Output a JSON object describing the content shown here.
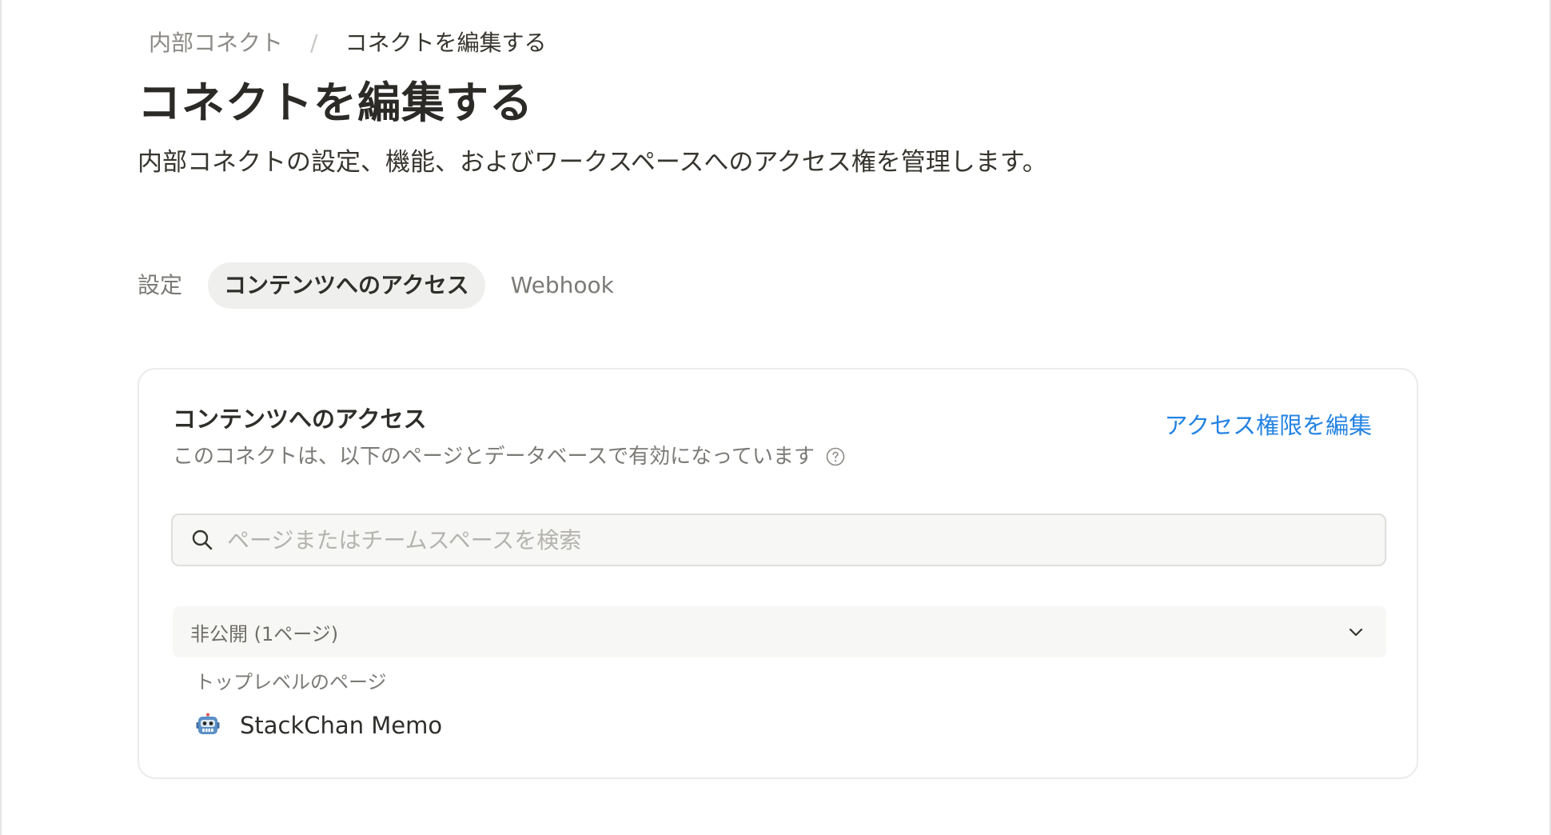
{
  "breadcrumb": {
    "parent": "内部コネクト",
    "separator": "/",
    "current": "コネクトを編集する"
  },
  "header": {
    "title": "コネクトを編集する",
    "description": "内部コネクトの設定、機能、およびワークスペースへのアクセス権を管理します。"
  },
  "tabs": [
    {
      "label": "設定",
      "active": false
    },
    {
      "label": "コンテンツへのアクセス",
      "active": true
    },
    {
      "label": "Webhook",
      "active": false
    }
  ],
  "content_access": {
    "title": "コンテンツへのアクセス",
    "subtitle": "このコネクトは、以下のページとデータベースで有効になっています",
    "edit_link": "アクセス権限を編集",
    "search": {
      "placeholder": "ページまたはチームスペースを検索",
      "value": ""
    },
    "group": {
      "label": "非公開 (1ページ)",
      "section_label": "トップレベルのページ",
      "items": [
        {
          "label": "StackChan Memo",
          "icon": "robot-icon"
        }
      ]
    }
  },
  "colors": {
    "accent": "#2383e2",
    "active_tab_bg": "#efefed",
    "search_bg": "#f7f7f5"
  }
}
